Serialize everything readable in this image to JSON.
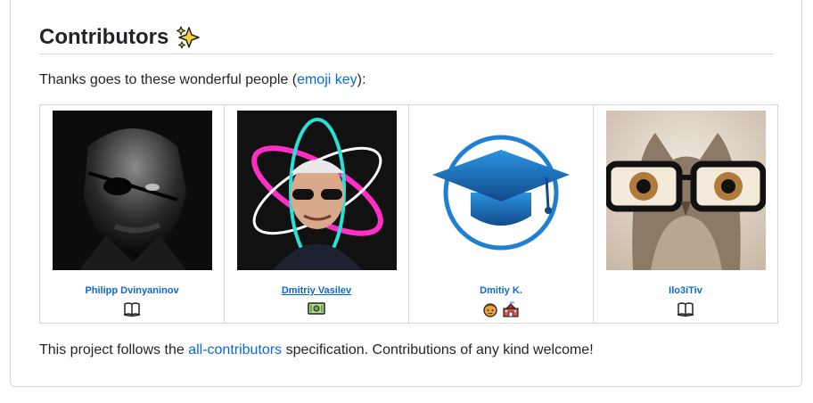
{
  "section": {
    "title": "Contributors",
    "title_icon": "sparkles-icon"
  },
  "thanks": {
    "prefix": "Thanks goes to these wonderful people (",
    "link": "emoji key",
    "suffix": "):"
  },
  "contributors": [
    {
      "name": "Philipp Dvinyaninov",
      "avatar": "eyepatch-man-portrait",
      "contributions": [
        "book-icon"
      ]
    },
    {
      "name": "Dmitriy Vasilev",
      "avatar": "man-with-sunglasses-react-logo",
      "contributions": [
        "dollar-bill-icon"
      ]
    },
    {
      "name": "Dmitiy K.",
      "avatar": "graduation-cap-logo",
      "contributions": [
        "mentor-face-icon",
        "school-icon"
      ]
    },
    {
      "name": "Ilo3iTiv",
      "avatar": "owl-with-glasses",
      "contributions": [
        "book-icon"
      ]
    }
  ],
  "footer": {
    "prefix": "This project follows the ",
    "link": "all-contributors",
    "suffix": " specification. Contributions of any kind welcome!"
  },
  "colors": {
    "link": "#0969da",
    "border": "#d0d7de",
    "text": "#1f2328"
  }
}
